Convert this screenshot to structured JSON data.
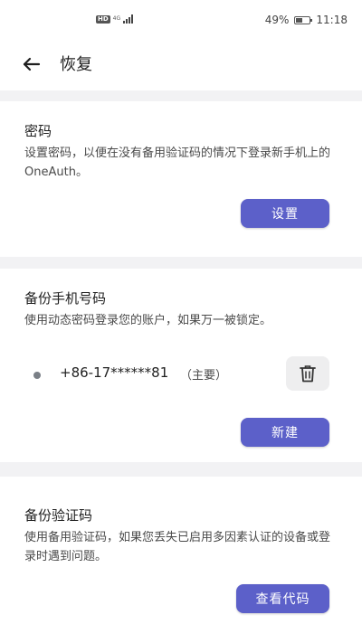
{
  "status_bar": {
    "hd_label": "HD",
    "network_label": "4G",
    "battery_percent": "49%",
    "battery_level": 0.49,
    "time": "11:18"
  },
  "app_bar": {
    "back_icon": "arrow-left-icon",
    "title": "恢复"
  },
  "password_section": {
    "title": "密码",
    "description": "设置密码，以便在没有备用验证码的情况下登录新手机上的OneAuth。",
    "button_label": "设置"
  },
  "backup_phone_section": {
    "title": "备份手机号码",
    "description": "使用动态密码登录您的账户，如果万一被锁定。",
    "phone": {
      "number": "+86-17******81",
      "tag": "（主要）",
      "delete_icon": "trash-icon"
    },
    "button_label": "新建"
  },
  "backup_codes_section": {
    "title": "备份验证码",
    "description": "使用备用验证码，如果您丢失已启用多因素认证的设备或登录时遇到问题。",
    "button_label": "查看代码"
  },
  "colors": {
    "accent": "#5c60c9",
    "background": "#f2f2f4",
    "card": "#ffffff"
  }
}
